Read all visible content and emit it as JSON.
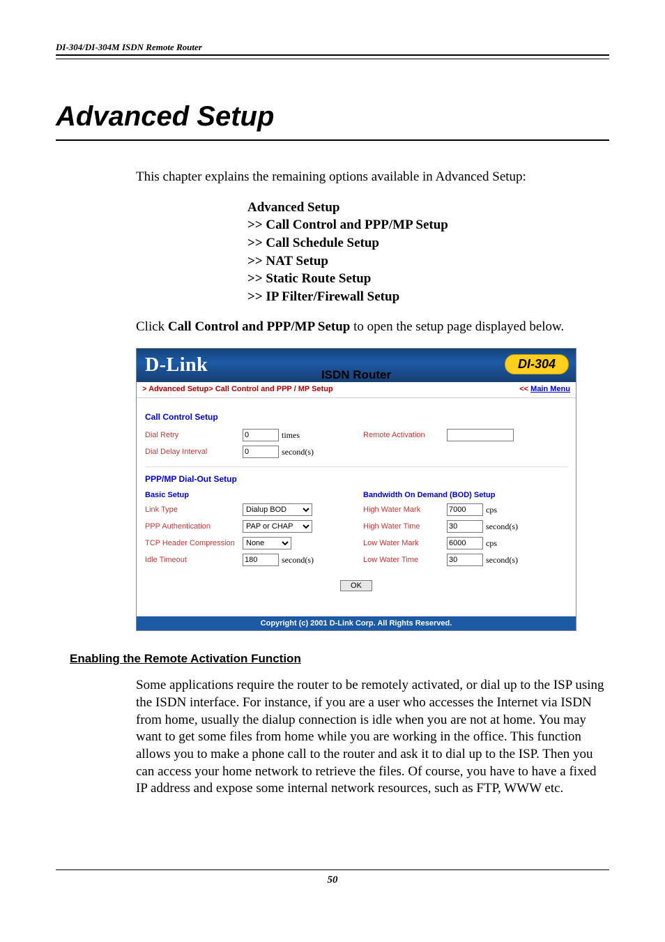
{
  "doc": {
    "running_header": "DI-304/DI-304M ISDN Remote Router",
    "chapter_title": "Advanced Setup",
    "intro": "This chapter explains the remaining options available in Advanced Setup:",
    "setup_list_heading": "Advanced Setup",
    "setup_items": [
      ">> Call Control and PPP/MP Setup",
      ">> Call Schedule Setup",
      ">> NAT Setup",
      ">> Static Route Setup",
      ">> IP Filter/Firewall Setup"
    ],
    "click_line_pre": "Click ",
    "click_line_bold": "Call Control and PPP/MP Setup",
    "click_line_post": " to open the setup page displayed below.",
    "subsection": "Enabling the Remote Activation Function",
    "body_para": "Some applications require the router to be remotely activated, or dial up to the ISP using the ISDN interface. For instance, if you are a user who accesses the Internet via ISDN from home, usually the dialup connection is idle when you are not at home. You may want to get some files from home while you are working in the office. This function allows you to make a phone call to the router and ask it to dial up to the ISP. Then you can access your home network to retrieve the files. Of course, you have to have a fixed IP address and expose some internal network resources, such as FTP, WWW etc.",
    "page_number": "50"
  },
  "router": {
    "logo": "D-Link",
    "title": "ISDN Router",
    "model": "DI-304",
    "breadcrumb": "> Advanced Setup> Call Control and PPP / MP Setup",
    "mainmenu_pre": "<< ",
    "mainmenu": "Main Menu",
    "section_call": "Call Control Setup",
    "dial_retry": {
      "label": "Dial Retry",
      "value": "0",
      "unit": "times"
    },
    "dial_delay": {
      "label": "Dial Delay Interval",
      "value": "0",
      "unit": "second(s)"
    },
    "remote_activation": {
      "label": "Remote Activation",
      "value": ""
    },
    "section_ppp": "PPP/MP Dial-Out Setup",
    "basic_title": "Basic Setup",
    "link_type": {
      "label": "Link Type",
      "value": "Dialup BOD"
    },
    "ppp_auth": {
      "label": "PPP Authentication",
      "value": "PAP or CHAP"
    },
    "tcp_comp": {
      "label": "TCP Header Compression",
      "value": "None"
    },
    "idle_timeout": {
      "label": "Idle Timeout",
      "value": "180",
      "unit": "second(s)"
    },
    "bod_title": "Bandwidth On Demand (BOD) Setup",
    "hwm": {
      "label": "High Water Mark",
      "value": "7000",
      "unit": "cps"
    },
    "hwt": {
      "label": "High Water Time",
      "value": "30",
      "unit": "second(s)"
    },
    "lwm": {
      "label": "Low Water Mark",
      "value": "6000",
      "unit": "cps"
    },
    "lwt": {
      "label": "Low Water Time",
      "value": "30",
      "unit": "second(s)"
    },
    "ok": "OK",
    "copyright": "Copyright (c) 2001 D-Link Corp. All Rights Reserved."
  }
}
